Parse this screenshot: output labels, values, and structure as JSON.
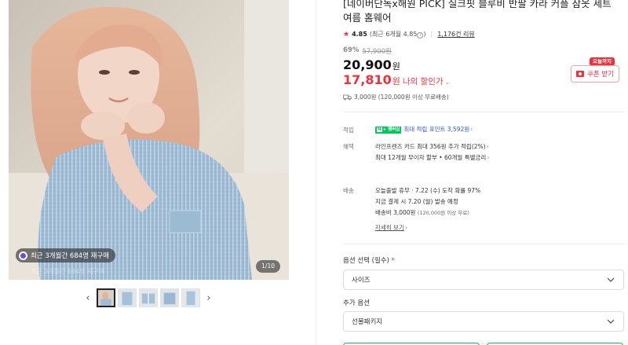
{
  "gallery": {
    "repurchase_badge": "최근 3개월간 684명 재구매",
    "faded_caption": "최근 3개월간 684명 재구매",
    "page_counter": "1/10",
    "thumbnail_count": 5,
    "prev_label": "‹",
    "next_label": "›"
  },
  "product": {
    "title": "[네이버단독x해원 PICK] 실크핏 블루비 반팔 카라 커플 잠옷 세트 여름 홈웨어",
    "rating": {
      "star": "★",
      "score": "4.85",
      "recent_text": "(최근 6개월 4.85",
      "info_icon": "i",
      "recent_close": ")",
      "review_link": "1,176건 리뷰"
    },
    "discount_rate": "69%",
    "original_price": "57,900원",
    "price": "20,900",
    "price_unit": "원",
    "my_sale_price": "17,810",
    "my_sale_unit": "원",
    "my_sale_label": "나의 할인가",
    "shipping_summary": "3,000원 (120,000원 이상 무료배송)",
    "today_badge": "오늘까지",
    "coupon_button": "쿠폰 받기"
  },
  "benefits": {
    "points": {
      "label": "적립",
      "npay_n": "N",
      "npay_plus": "+ 멤버십",
      "text": "최대 적립 포인트 3,592원",
      "chevron": "›"
    },
    "perks": {
      "label": "혜택",
      "line1": "라인프렌즈 카드 최대 356원 추가 적립(2%)",
      "line2": "최대 12개월 무이자 할부 • 60개월 특별금리",
      "chevron": "›"
    },
    "delivery": {
      "label": "배송",
      "line1": "오늘출발 휴무 · 7.22 (수) 도착 확률 97%",
      "line2": "지금 결제 시 7.20 (월) 발송 예정",
      "line3_a": "배송비 3,000원",
      "line3_b": "(120,000원 이상 무료)",
      "detail_link": "자세히 보기",
      "chevron": "›"
    }
  },
  "options": {
    "option_label": "옵션 선택 (필수)",
    "required_mark": "*",
    "size_select": "사이즈",
    "extra_label": "추가 옵션",
    "extra_select": "선물패키지"
  },
  "colors": {
    "accent_red": "#f0313b",
    "naver_green": "#03c75a",
    "link_blue": "#2b56d6"
  }
}
